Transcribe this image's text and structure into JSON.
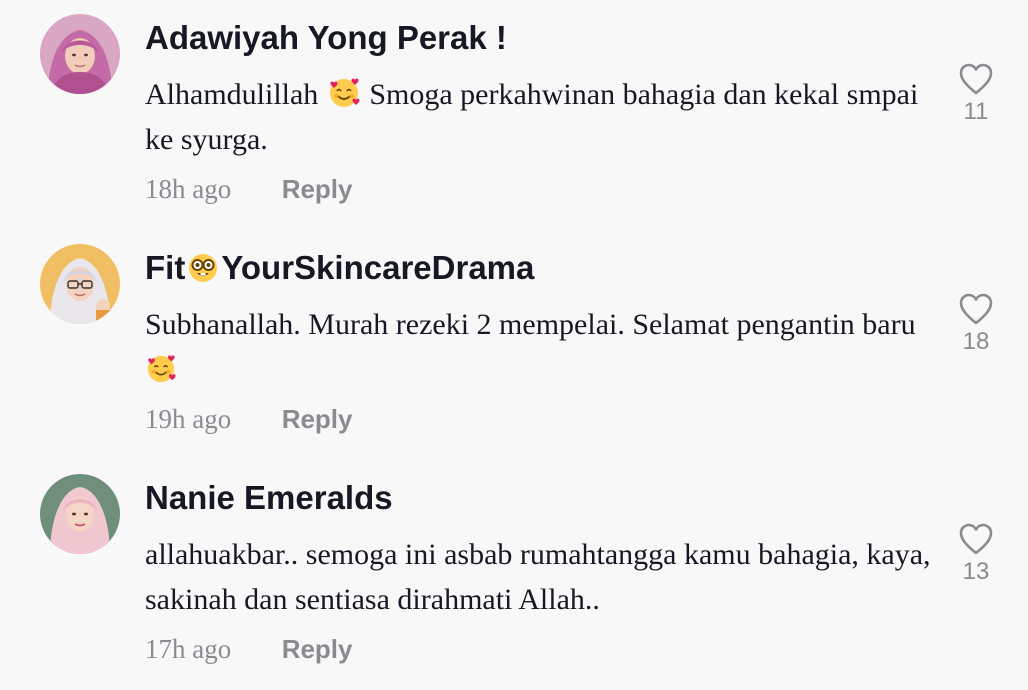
{
  "colors": {
    "background": "#f8f8f8",
    "text": "#161823",
    "secondary": "#8a8b91"
  },
  "comments": [
    {
      "username": "Adawiyah Yong Perak !",
      "text_before": "Alhamdulillah ",
      "emoji": "smiling-face-with-hearts",
      "text_after": " Smoga perkahwinan bahagia dan kekal smpai ke syurga.",
      "time": "18h ago",
      "reply_label": "Reply",
      "likes": "11",
      "like_icon": "heart-outline-icon"
    },
    {
      "username_before": "Fit",
      "username_emoji": "nerd-face",
      "username_after": "YourSkincareDrama",
      "text_before": "Subhanallah. Murah rezeki 2 mempelai. Selamat pengantin baru",
      "emoji": "smiling-face-with-hearts",
      "time": "19h ago",
      "reply_label": "Reply",
      "likes": "18",
      "like_icon": "heart-outline-icon"
    },
    {
      "username": "Nanie Emeralds",
      "text_before": "allahuakbar.. semoga ini asbab rumahtangga kamu bahagia, kaya, sakinah dan sentiasa dirahmati Allah..",
      "time": "17h ago",
      "reply_label": "Reply",
      "likes": "13",
      "like_icon": "heart-outline-icon"
    }
  ]
}
